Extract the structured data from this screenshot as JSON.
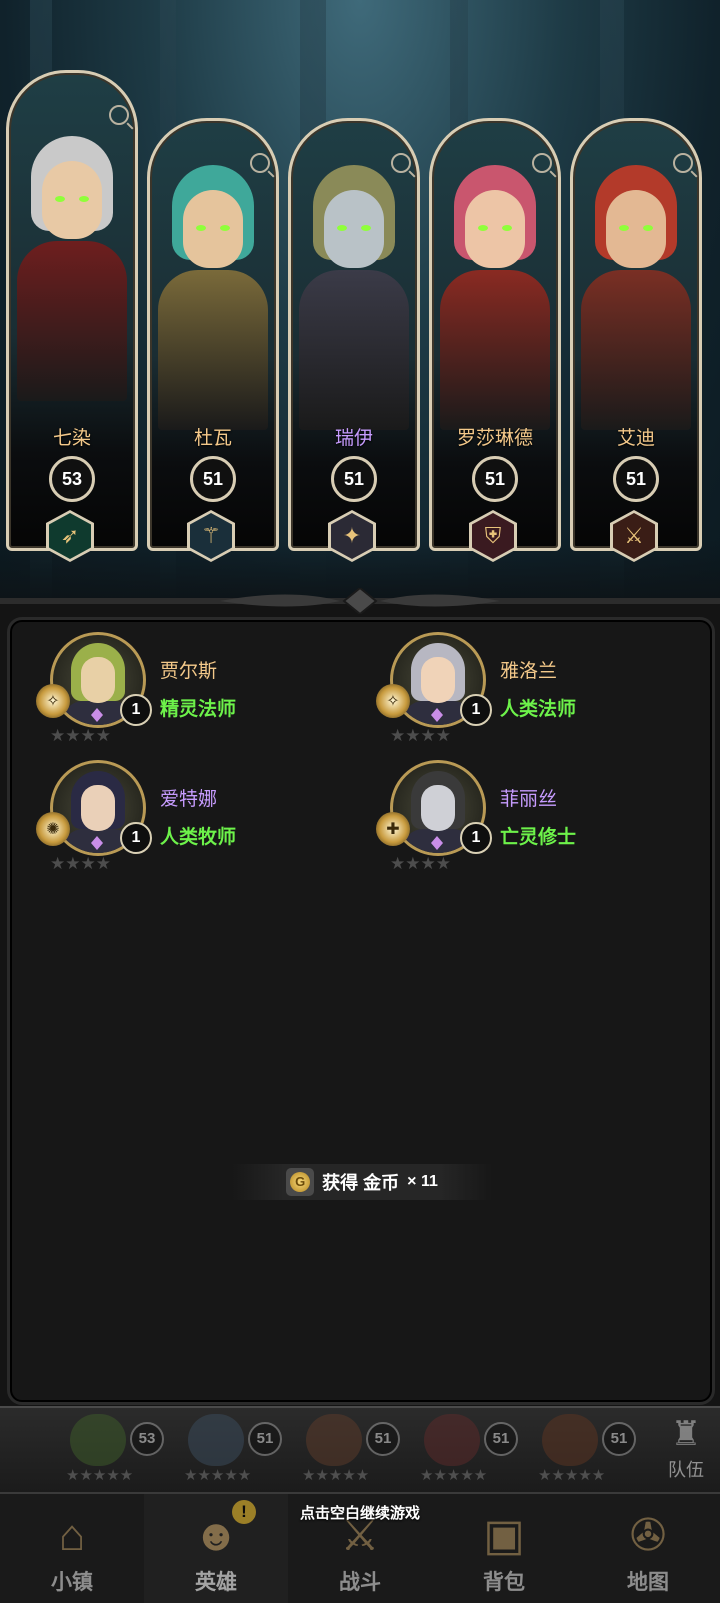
{
  "heroes": [
    {
      "name": "七染",
      "level": "53",
      "class_icon": "bow-icon",
      "hair": "#c9c9c9",
      "skin": "#e8c9a5",
      "armor": "#6e1e1e"
    },
    {
      "name": "杜瓦",
      "level": "51",
      "class_icon": "orb-staff-icon",
      "hair": "#3fa89a",
      "skin": "#e5c49c",
      "armor": "#7a6a3a"
    },
    {
      "name": "瑞伊",
      "level": "51",
      "class_icon": "holy-sigil-icon",
      "hair": "#8a8a58",
      "skin": "#b9c2c7",
      "armor": "#3b3b48"
    },
    {
      "name": "罗莎琳德",
      "level": "51",
      "class_icon": "shield-icon",
      "hair": "#c9566e",
      "skin": "#edc5a6",
      "armor": "#8a2a22"
    },
    {
      "name": "艾迪",
      "level": "51",
      "class_icon": "sword-icon",
      "hair": "#b33a2a",
      "skin": "#e3b893",
      "armor": "#7a2f24"
    }
  ],
  "recruits": [
    {
      "name": "贾尔斯",
      "class": "精灵法师",
      "level": "1",
      "stars": "★★★★",
      "name_color": "gold",
      "hair": "#9bb04a",
      "skin": "#e8d0a6",
      "class_icon": "staff-orb-icon"
    },
    {
      "name": "雅洛兰",
      "class": "人类法师",
      "level": "1",
      "stars": "★★★★",
      "name_color": "gold",
      "hair": "#b7b7c2",
      "skin": "#f0d3b8",
      "class_icon": "staff-orb-icon"
    },
    {
      "name": "爱特娜",
      "class": "人类牧师",
      "level": "1",
      "stars": "★★★★",
      "name_color": "purple",
      "hair": "#2a2a44",
      "skin": "#ead0b8",
      "class_icon": "holy-sigil-icon"
    },
    {
      "name": "菲丽丝",
      "class": "亡灵修士",
      "level": "1",
      "stars": "★★★★",
      "name_color": "purple",
      "hair": "#3a3a3a",
      "skin": "#cfd0d6",
      "class_icon": "cross-icon"
    }
  ],
  "reward": {
    "label": "获得 金币",
    "quantity": "× 11",
    "icon": "gold-coin-icon"
  },
  "team_strip": {
    "levels": [
      "53",
      "51",
      "51",
      "51",
      "51"
    ],
    "button_label": "队伍",
    "button_icon": "chess-pieces-icon"
  },
  "nav": [
    {
      "label": "小镇",
      "icon": "town-icon"
    },
    {
      "label": "英雄",
      "icon": "hero-portrait-icon",
      "active": true,
      "alert": "!"
    },
    {
      "label": "战斗",
      "icon": "crossed-swords-icon"
    },
    {
      "label": "背包",
      "icon": "backpack-icon"
    },
    {
      "label": "地图",
      "icon": "map-icon"
    }
  ],
  "continue_hint": "点击空白继续游戏",
  "colors": {
    "gold_text": "#f4c98a",
    "purple_text": "#c79cff",
    "class_green": "#6df24a",
    "frame": "#d8cdb4"
  }
}
